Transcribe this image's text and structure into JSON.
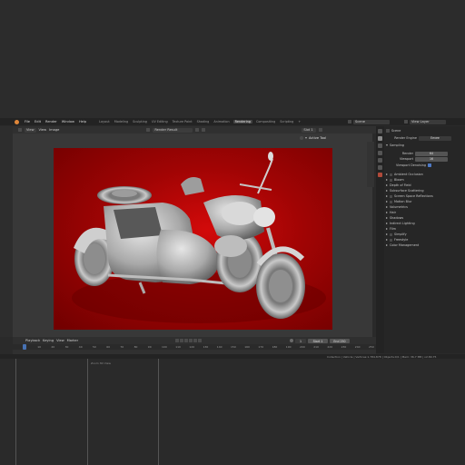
{
  "menu": {
    "items": [
      "File",
      "Edit",
      "Render",
      "Window",
      "Help"
    ],
    "workspaces": [
      "Layout",
      "Modeling",
      "Sculpting",
      "UV Editing",
      "Texture Paint",
      "Shading",
      "Animation",
      "Rendering",
      "Compositing",
      "Scripting"
    ],
    "active_workspace": "Rendering",
    "add_tab": "+",
    "scene_label": "Scene",
    "view_layer_label": "View Layer"
  },
  "image_editor": {
    "mode": "View",
    "menus": [
      "View",
      "Image"
    ],
    "image_name": "Render Result",
    "slot": "Slot 1",
    "active_tool": "Active Tool"
  },
  "properties": {
    "scene_title": "Scene",
    "render_engine_label": "Render Engine",
    "render_engine_value": "Eevee",
    "sampling_label": "Sampling",
    "render_label": "Render",
    "render_value": "64",
    "viewport_label": "Viewport",
    "viewport_value": "16",
    "viewport_denoising_label": "Viewport Denoising",
    "panels": [
      "Ambient Occlusion",
      "Bloom",
      "Depth of Field",
      "Subsurface Scattering",
      "Screen Space Reflections",
      "Motion Blur",
      "Volumetrics",
      "Hair",
      "Shadows",
      "Indirect Lighting",
      "Film",
      "Simplify",
      "Freestyle",
      "Color Management"
    ],
    "checkbox_panels": [
      "Ambient Occlusion",
      "Bloom",
      "Screen Space Reflections",
      "Motion Blur",
      "Simplify",
      "Freestyle"
    ]
  },
  "timeline": {
    "menus": [
      "Playback",
      "Keying",
      "View",
      "Marker"
    ],
    "ticks": [
      "0",
      "10",
      "20",
      "30",
      "40",
      "50",
      "60",
      "70",
      "80",
      "90",
      "100",
      "110",
      "120",
      "130",
      "140",
      "150",
      "160",
      "170",
      "180",
      "190",
      "200",
      "210",
      "220",
      "230",
      "240",
      "250"
    ],
    "current_frame": "1",
    "start_label": "Start",
    "start_value": "1",
    "end_label": "End",
    "end_value": "250"
  },
  "status": {
    "text": "Collection | Vehicle | Vertices:1,784,878 | Objects:0/1 | Mem: 36.7 MB | v2.80.75"
  },
  "lower": {
    "label": "Zoom 3D View"
  },
  "colors": {
    "accent": "#4772b3",
    "background_red": "#b00505",
    "panel_bg": "#262626"
  }
}
